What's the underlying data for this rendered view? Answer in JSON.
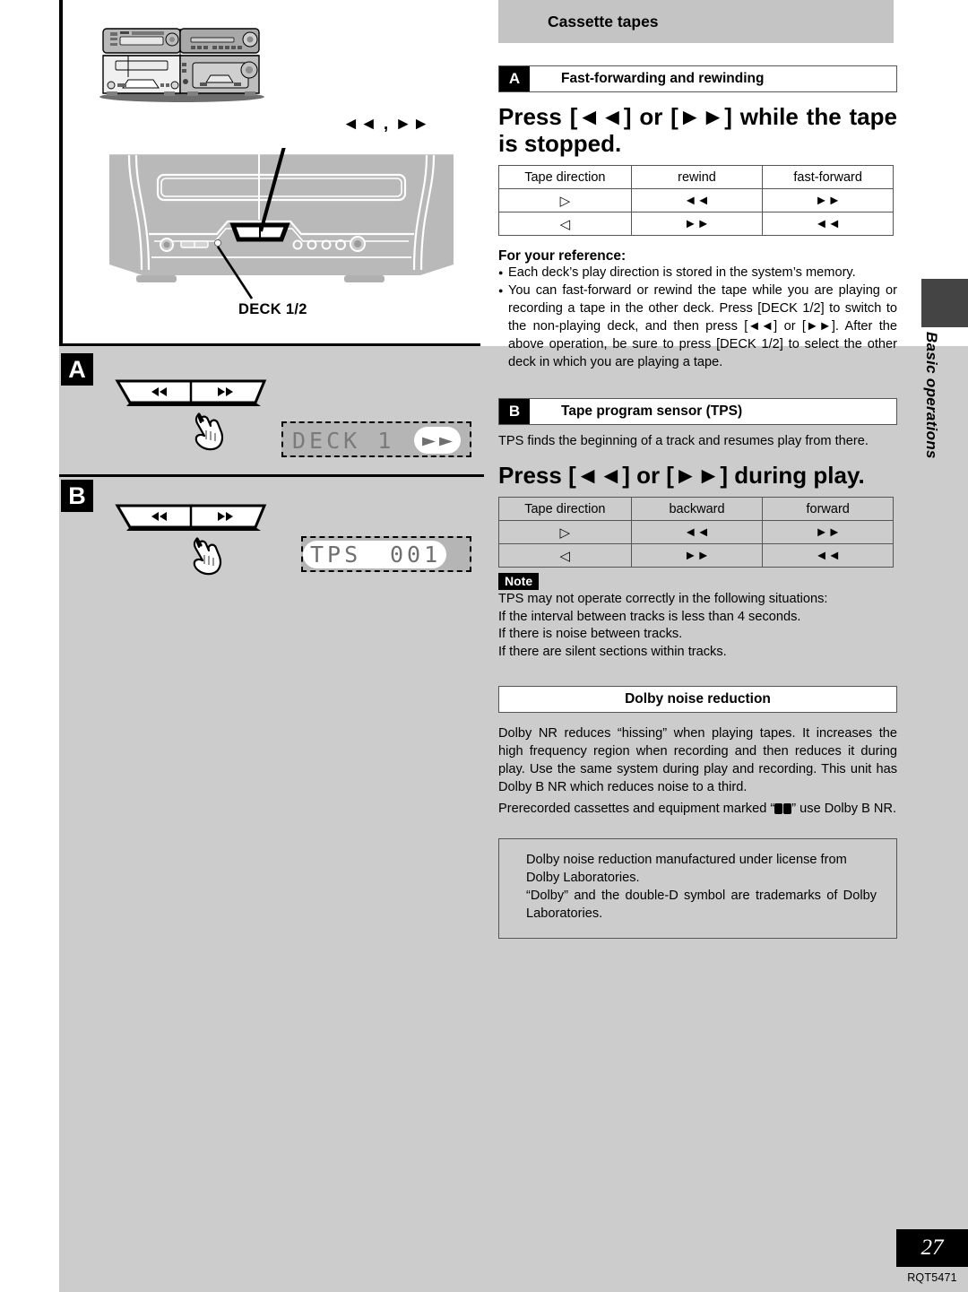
{
  "header": {
    "title": "Cassette tapes"
  },
  "left_illustration": {
    "ff_rew_label": "◄◄ , ►►",
    "deck_label": "DECK 1/2",
    "section_a_badge": "A",
    "section_b_badge": "B",
    "lcd_a": {
      "text": "DECK 1",
      "highlight": "►►"
    },
    "lcd_b": {
      "text": "TPS",
      "value": "001"
    },
    "rocker_left_icon": "◄◄",
    "rocker_right_icon": "►►"
  },
  "section_a": {
    "badge": "A",
    "title": "Fast-forwarding and rewinding",
    "instruction": "Press [◄◄] or [►►] while the tape is stopped.",
    "table": {
      "headers": [
        "Tape direction",
        "rewind",
        "fast-forward"
      ],
      "rows": [
        {
          "direction": "▷",
          "c2": "◄◄",
          "c3": "►►"
        },
        {
          "direction": "◁",
          "c2": "►►",
          "c3": "◄◄"
        }
      ]
    },
    "reference_title": "For your reference:",
    "reference_items": [
      "Each deck’s play direction is stored in the system’s memory.",
      "You can fast-forward or rewind the tape while you are playing or recording a tape in the other deck. Press [DECK 1/2] to switch to the non-playing deck, and then press [◄◄] or [►►]. After the above operation, be sure to press [DECK 1/2] to select the other deck in which you are playing a tape."
    ]
  },
  "section_b": {
    "badge": "B",
    "title": "Tape program sensor (TPS)",
    "intro": "TPS finds the beginning of a track and resumes play from there.",
    "instruction": "Press [◄◄] or [►►] during play.",
    "table": {
      "headers": [
        "Tape direction",
        "backward",
        "forward"
      ],
      "rows": [
        {
          "direction": "▷",
          "c2": "◄◄",
          "c3": "►►"
        },
        {
          "direction": "◁",
          "c2": "►►",
          "c3": "◄◄"
        }
      ]
    },
    "note_badge": "Note",
    "note_lines": [
      "TPS may not operate correctly in the following situations:",
      "If the interval between tracks is less than 4 seconds.",
      "If there is noise between tracks.",
      "If there are silent sections within tracks."
    ]
  },
  "dolby": {
    "title": "Dolby noise reduction",
    "paragraph1": "Dolby NR reduces “hissing” when playing tapes. It increases the high frequency region when recording and then reduces it during play. Use the same system during play and recording. This unit has Dolby B NR which reduces noise to a third.",
    "paragraph2_before": "Prerecorded cassettes and equipment marked “",
    "paragraph2_after": "” use Dolby B NR.",
    "license_line1": "Dolby noise reduction manufactured under license from Dolby Laboratories.",
    "license_line2": "“Dolby” and the double-D symbol are trademarks of Dolby Laboratories."
  },
  "side_tab": {
    "label": "Basic operations"
  },
  "footer": {
    "page_number": "27",
    "doc_code": "RQT5471"
  },
  "colors": {
    "header_gray": "#c4c4c4",
    "panel_gray": "#cccccc",
    "tab_dark": "#444444",
    "lcd_gray": "#b5b5b5"
  }
}
